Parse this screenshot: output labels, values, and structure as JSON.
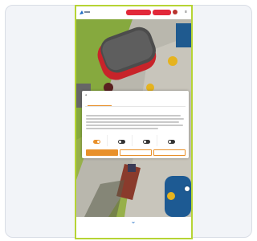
{
  "header": {
    "logo_icon": "brand-logo",
    "button_primary": "",
    "button_secondary": "",
    "language_icon": "flag-icon",
    "menu_icon": "hamburger-menu-icon",
    "accent_color": "#e2283a"
  },
  "hero": {
    "image_description_icon": "aerial-photo-of-red-caravan"
  },
  "consent_dialog": {
    "tabs": [
      "",
      "",
      ""
    ],
    "active_tab_index": 0,
    "heading": "",
    "categories": [
      {
        "label": "",
        "enabled": true
      },
      {
        "label": "",
        "enabled": false
      },
      {
        "label": "",
        "enabled": false
      },
      {
        "label": "",
        "enabled": false
      }
    ],
    "buttons": [
      "",
      "",
      ""
    ],
    "accent_color": "#e8902a"
  },
  "footer": {
    "scroll_icon": "chevron-down-icon",
    "accent_color": "#1e6cc4"
  },
  "frame": {
    "border_color": "#b6d434"
  }
}
